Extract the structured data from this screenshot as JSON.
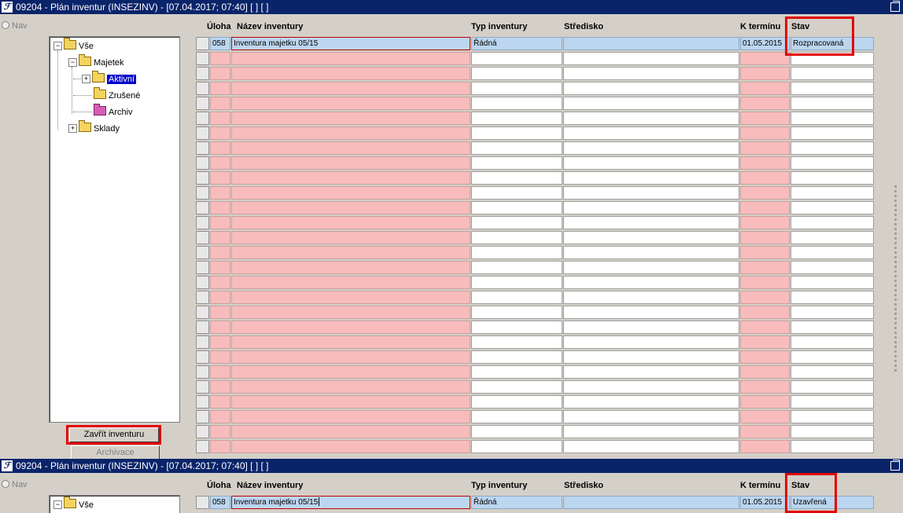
{
  "window1": {
    "title": "09204 - Plán inventur (INSEZINV) - [07.04.2017; 07:40]  [ ] [ ]",
    "nav_label": "Nav",
    "tree": {
      "root": "Vše",
      "majetek": "Majetek",
      "aktivni": "Aktivní",
      "zrusene": "Zrušené",
      "archiv": "Archiv",
      "sklady": "Sklady"
    },
    "buttons": {
      "close_inventory": "Zavřít inventuru",
      "archive": "Archivace"
    },
    "columns": {
      "uloha": "Úloha",
      "nazev": "Název inventury",
      "typ": "Typ inventury",
      "stredisko": "Středisko",
      "termin": "K termínu",
      "stav": "Stav"
    },
    "row": {
      "uloha": "058",
      "nazev": "Inventura majetku 05/15",
      "typ": "Řádná",
      "stredisko": "",
      "termin": "01.05.2015",
      "stav": "Rozpracovaná"
    }
  },
  "window2": {
    "title": "09204 - Plán inventur (INSEZINV) - [07.04.2017; 07:40]  [ ] [ ]",
    "nav_label": "Nav",
    "tree": {
      "root": "Vše"
    },
    "columns": {
      "uloha": "Úloha",
      "nazev": "Název inventury",
      "typ": "Typ inventury",
      "stredisko": "Středisko",
      "termin": "K termínu",
      "stav": "Stav"
    },
    "row": {
      "uloha": "058",
      "nazev": "Inventura majetku 05/15",
      "typ": "Řádná",
      "stredisko": "",
      "termin": "01.05.2015",
      "stav": "Uzavřená"
    }
  },
  "colors": {
    "titlebar": "#0a246a",
    "required_field": "#f9bcbc",
    "selected_row": "#bcd6f0",
    "highlight": "#e30000"
  }
}
